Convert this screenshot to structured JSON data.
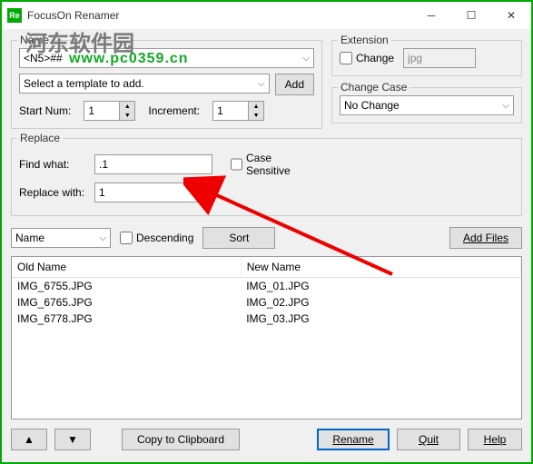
{
  "window": {
    "title": "FocusOn Renamer",
    "icon_text": "Re"
  },
  "watermark": {
    "line1": "河东软件园",
    "line2": "www.pc0359.cn"
  },
  "name_section": {
    "legend": "Name",
    "pattern": "<N5>##",
    "template_placeholder": "Select a template to add.",
    "add_btn": "Add",
    "start_num_label": "Start Num:",
    "start_num_value": "1",
    "increment_label": "Increment:",
    "increment_value": "1"
  },
  "extension_section": {
    "legend": "Extension",
    "change_label": "Change",
    "ext_value": "jpg"
  },
  "case_section": {
    "legend": "Change Case",
    "value": "No Change"
  },
  "replace_section": {
    "legend": "Replace",
    "find_label": "Find what:",
    "find_value": ".1",
    "replace_label": "Replace with:",
    "replace_value": "1",
    "case_sensitive_label": "Case Sensitive"
  },
  "sort_row": {
    "sort_field": "Name",
    "descending_label": "Descending",
    "sort_btn": "Sort",
    "add_files_btn": "Add Files"
  },
  "table": {
    "headers": {
      "old": "Old Name",
      "new": "New Name"
    },
    "rows": [
      {
        "old": "IMG_6755.JPG",
        "new": "IMG_01.JPG"
      },
      {
        "old": "IMG_6765.JPG",
        "new": "IMG_02.JPG"
      },
      {
        "old": "IMG_6778.JPG",
        "new": "IMG_03.JPG"
      }
    ]
  },
  "bottom": {
    "up": "▲",
    "down": "▼",
    "copy_btn": "Copy to Clipboard",
    "rename_btn": "Rename",
    "quit_btn": "Quit",
    "help_btn": "Help"
  }
}
